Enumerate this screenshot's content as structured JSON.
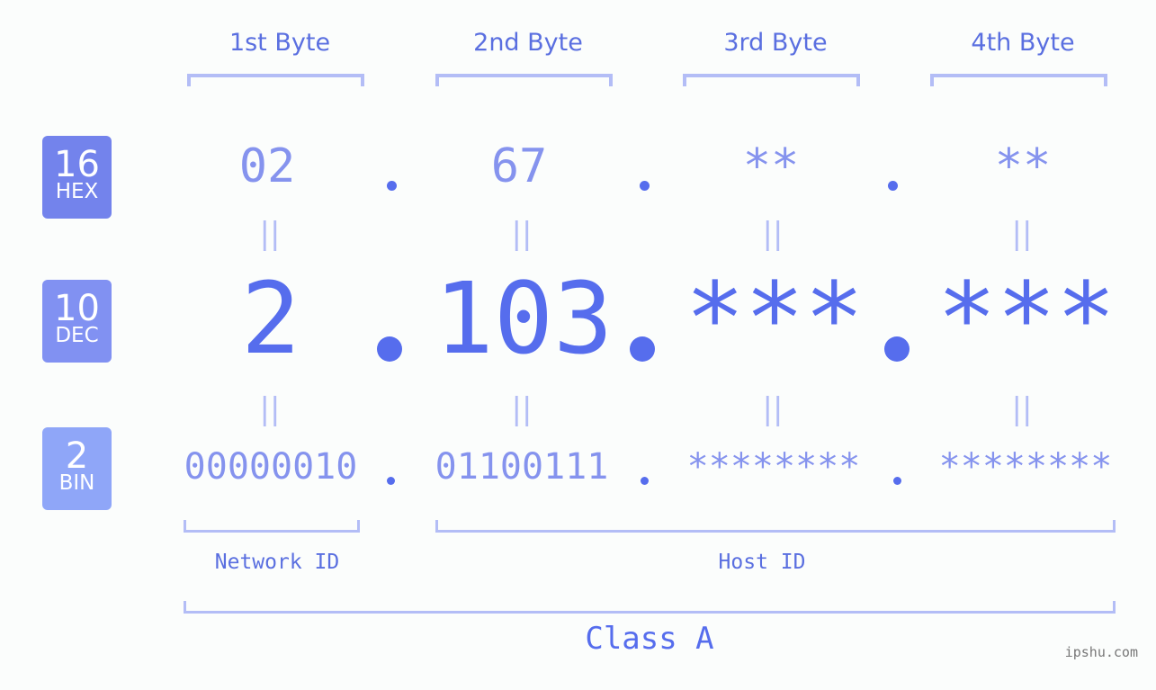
{
  "bytes": [
    {
      "label": "1st Byte",
      "hex": "02",
      "dec": "2",
      "bin": "00000010"
    },
    {
      "label": "2nd Byte",
      "hex": "67",
      "dec": "103",
      "bin": "01100111"
    },
    {
      "label": "3rd Byte",
      "hex": "**",
      "dec": "***",
      "bin": "********"
    },
    {
      "label": "4th Byte",
      "hex": "**",
      "dec": "***",
      "bin": "********"
    }
  ],
  "badges": [
    {
      "num": "16",
      "unit": "HEX",
      "color": "#7383ec"
    },
    {
      "num": "10",
      "unit": "DEC",
      "color": "#8191f2"
    },
    {
      "num": "2",
      "unit": "BIN",
      "color": "#8fa6f8"
    }
  ],
  "equals_symbol": "||",
  "network_id_label": "Network ID",
  "host_id_label": "Host ID",
  "class_label": "Class A",
  "watermark": "ipshu.com",
  "colors": {
    "primary": "#566ded",
    "light": "#8593ee",
    "bracket": "#b3bdf6"
  }
}
